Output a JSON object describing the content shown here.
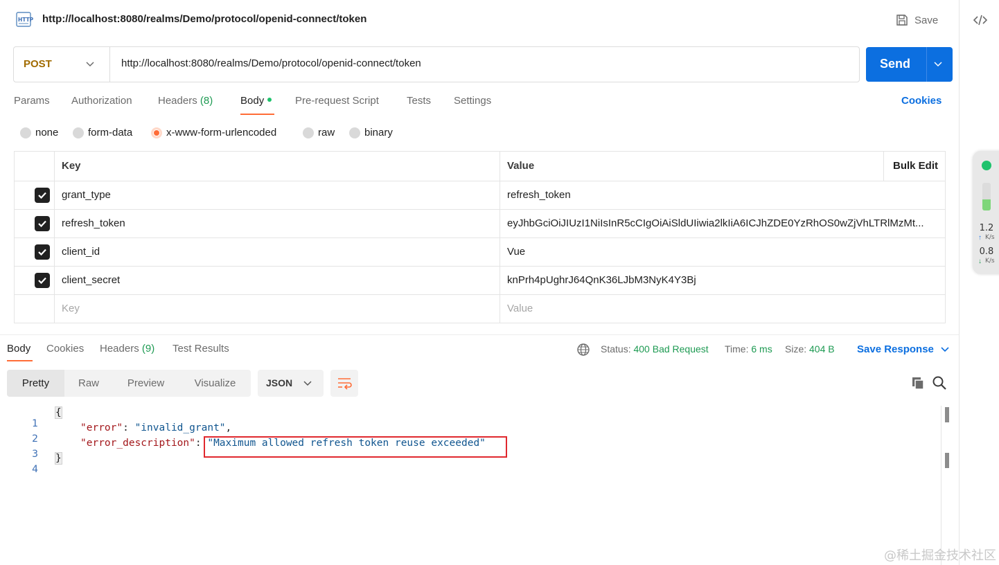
{
  "request": {
    "title": "http://localhost:8080/realms/Demo/protocol/openid-connect/token",
    "save_label": "Save",
    "method": "POST",
    "url": "http://localhost:8080/realms/Demo/protocol/openid-connect/token",
    "send_label": "Send"
  },
  "request_tabs": {
    "params": "Params",
    "authorization": "Authorization",
    "headers": "Headers",
    "headers_count": "(8)",
    "body": "Body",
    "pre_request": "Pre-request Script",
    "tests": "Tests",
    "settings": "Settings",
    "cookies": "Cookies",
    "active": "Body"
  },
  "body_types": {
    "none": "none",
    "form_data": "form-data",
    "urlencoded": "x-www-form-urlencoded",
    "raw": "raw",
    "binary": "binary",
    "selected": "x-www-form-urlencoded"
  },
  "params_table": {
    "key_header": "Key",
    "value_header": "Value",
    "bulk_edit": "Bulk Edit",
    "rows": [
      {
        "key": "grant_type",
        "value": "refresh_token",
        "checked": true
      },
      {
        "key": "refresh_token",
        "value": "eyJhbGciOiJIUzI1NiIsInR5cCIgOiAiSldUIiwia2lkIiA6ICJhZDE0YzRhOS0wZjVhLTRlMzMt...",
        "checked": true
      },
      {
        "key": "client_id",
        "value": "Vue",
        "checked": true
      },
      {
        "key": "client_secret",
        "value": "knPrh4pUghrJ64QnK36LJbM3NyK4Y3Bj",
        "checked": true
      }
    ],
    "key_placeholder": "Key",
    "value_placeholder": "Value"
  },
  "response_tabs": {
    "body": "Body",
    "cookies": "Cookies",
    "headers": "Headers",
    "headers_count": "(9)",
    "test_results": "Test Results",
    "active": "Body"
  },
  "response_meta": {
    "status_label": "Status:",
    "status_value": "400 Bad Request",
    "time_label": "Time:",
    "time_value": "6 ms",
    "size_label": "Size:",
    "size_value": "404 B",
    "save_response": "Save Response"
  },
  "view_modes": {
    "pretty": "Pretty",
    "raw": "Raw",
    "preview": "Preview",
    "visualize": "Visualize",
    "active": "Pretty",
    "format": "JSON"
  },
  "response_body": {
    "line_numbers": [
      "1",
      "2",
      "3",
      "4"
    ],
    "open_brace": "{",
    "close_brace": "}",
    "error_key": "\"error\"",
    "error_value": "\"invalid_grant\"",
    "error_description_key": "\"error_description\"",
    "error_description_value": "\"Maximum allowed refresh token reuse exceeded\""
  },
  "network_widget": {
    "upload": "1.2",
    "download": "0.8",
    "unit": "K/s"
  },
  "watermark": "@稀土掘金技术社区",
  "colors": {
    "accent_orange": "#ff6c37",
    "send_blue": "#0c6fe0",
    "method_post": "#a16b00",
    "status_green": "#1d9a52",
    "highlight_red": "#e0282e"
  }
}
